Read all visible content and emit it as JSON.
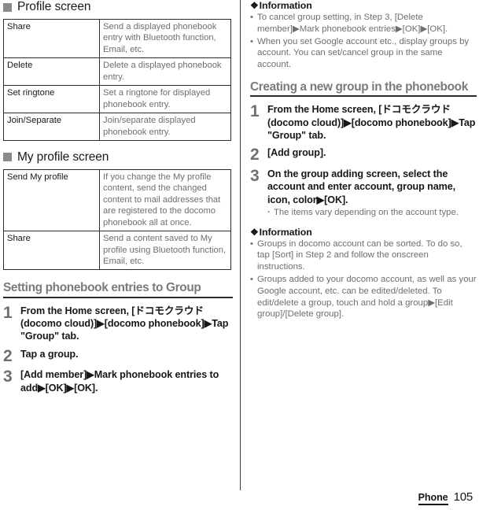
{
  "footer": {
    "chapter": "Phone",
    "page_number": "105"
  },
  "left_column": {
    "profile_section": {
      "bullet_icon": "gray-square-bullet",
      "heading": "Profile screen",
      "rows": [
        {
          "key": "Share",
          "value": "Send a displayed phonebook entry with Bluetooth function, Email, etc."
        },
        {
          "key": "Delete",
          "value": "Delete a displayed phonebook entry."
        },
        {
          "key": "Set ringtone",
          "value": "Set a ringtone for displayed phonebook entry."
        },
        {
          "key": "Join/Separate",
          "value": "Join/separate displayed phonebook entry."
        }
      ]
    },
    "my_profile_section": {
      "bullet_icon": "gray-square-bullet",
      "heading": "My profile screen",
      "rows": [
        {
          "key": "Send My profile",
          "value": "If you change the My profile content, send the changed content to mail addresses that are registered to the docomo phonebook all at once."
        },
        {
          "key": "Share",
          "value": "Send a content saved to My profile using Bluetooth function, Email, etc."
        }
      ]
    },
    "setting_group_section": {
      "heading": "Setting phonebook entries to Group",
      "steps": [
        {
          "number": "1",
          "text": "From the Home screen, [ドコモクラウド (docomo cloud)]▶[docomo phonebook]▶Tap \"Group\" tab."
        },
        {
          "number": "2",
          "text": "Tap a group."
        },
        {
          "number": "3",
          "text": "[Add member]▶Mark phonebook entries to add▶[OK]▶[OK]."
        }
      ]
    }
  },
  "right_column": {
    "information_top": {
      "glyph": "❖",
      "heading": "Information",
      "items": [
        "To cancel group setting, in Step 3, [Delete member]▶Mark phonebook entries▶[OK]▶[OK].",
        "When you set Google account etc., display groups by account. You can set/cancel group in the same account."
      ]
    },
    "creating_group_section": {
      "heading": "Creating a new group in the phonebook",
      "steps": [
        {
          "number": "1",
          "text": "From the Home screen, [ドコモクラウド (docomo cloud)]▶[docomo phonebook]▶Tap \"Group\" tab."
        },
        {
          "number": "2",
          "text": "[Add group]."
        },
        {
          "number": "3",
          "text": "On the group adding screen, select the account and enter account, group name, icon, color▶[OK].",
          "note": "The items vary depending on the account type."
        }
      ]
    },
    "information_bottom": {
      "glyph": "❖",
      "heading": "Information",
      "items": [
        "Groups in docomo account can be sorted. To do so, tap [Sort] in Step 2 and follow the onscreen instructions.",
        "Groups added to your docomo account, as well as your Google account, etc. can be edited/deleted. To edit/delete a group, touch and hold a group▶[Edit group]/[Delete group]."
      ]
    }
  }
}
